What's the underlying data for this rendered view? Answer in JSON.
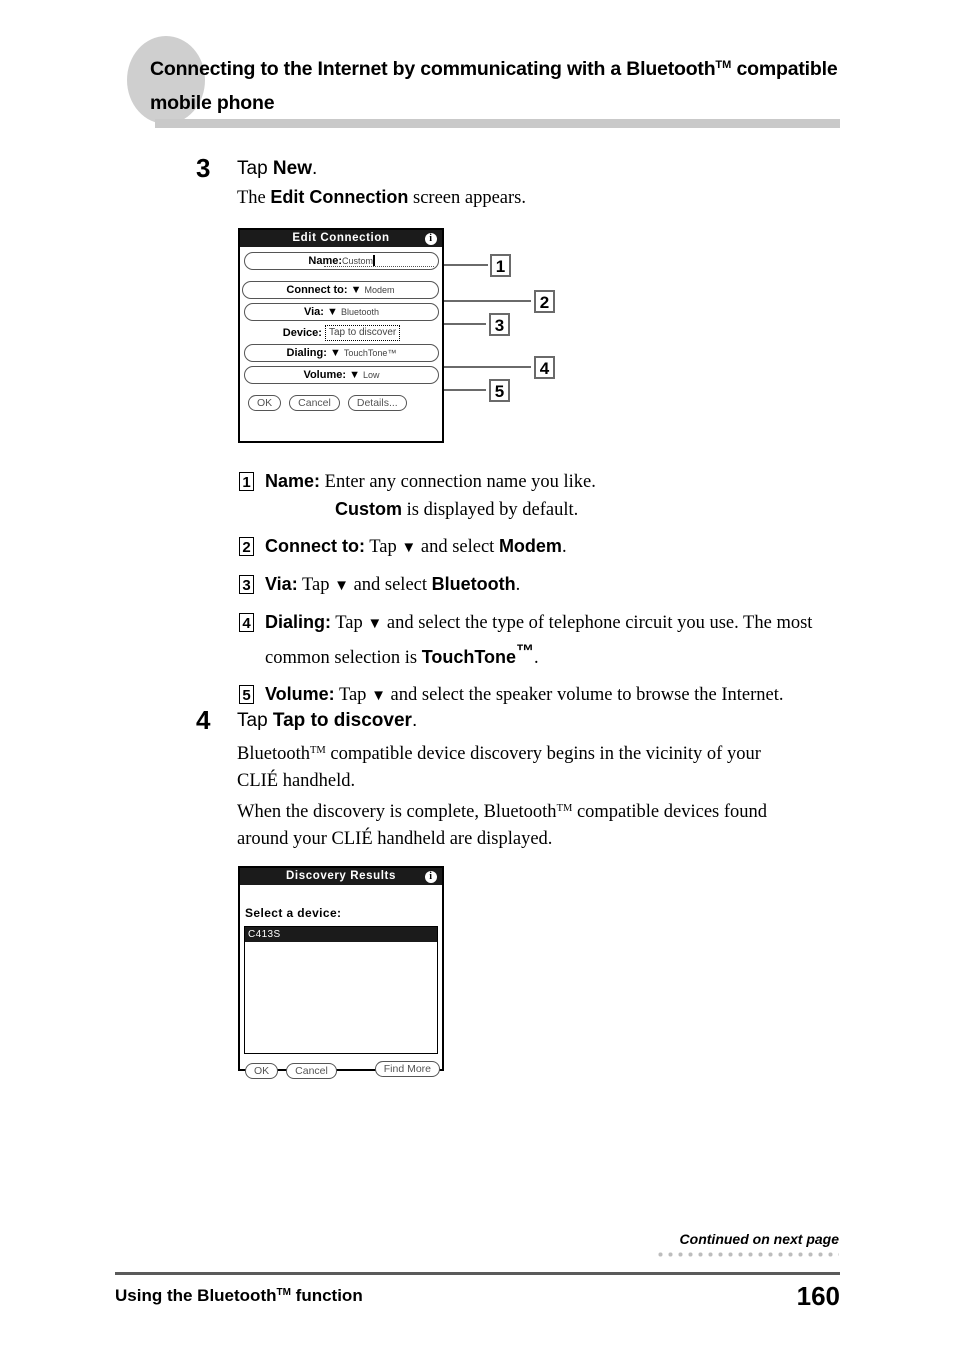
{
  "header": {
    "title_line1": "Connecting to the Internet by communicating with a Bluetooth",
    "title_tm": "TM",
    "title_line1b": " compatible",
    "title_line2": "mobile phone"
  },
  "step3": {
    "number": "3",
    "head_pre": "Tap ",
    "head_bold": "New",
    "head_post": ".",
    "body_pre": "The ",
    "body_bold": "Edit Connection",
    "body_post": " screen appears."
  },
  "edit_connection": {
    "title": "Edit Connection",
    "info_icon": "i",
    "name_label": "Name:",
    "name_value": "Custom",
    "connect_label": "Connect to:",
    "connect_value": "Modem",
    "via_label": "Via:",
    "via_value": "Bluetooth",
    "device_label": "Device:",
    "device_value": "Tap to discover",
    "dialing_label": "Dialing:",
    "dialing_value": "TouchTone™",
    "volume_label": "Volume:",
    "volume_value": "Low",
    "btn_ok": "OK",
    "btn_cancel": "Cancel",
    "btn_details": "Details...",
    "callouts": [
      "1",
      "2",
      "3",
      "4",
      "5"
    ]
  },
  "callout_list": [
    {
      "num": "1",
      "label": "Name:",
      "text": " Enter any connection name you like.",
      "line2_bold": "Custom",
      "line2_text": " is displayed by default."
    },
    {
      "num": "2",
      "label": "Connect to:",
      "text_a": " Tap ",
      "triangle": "▼",
      "text_b": " and select ",
      "strong": "Modem",
      "text_c": "."
    },
    {
      "num": "3",
      "label": "Via:",
      "text_a": " Tap ",
      "triangle": "▼",
      "text_b": " and select ",
      "strong": "Bluetooth",
      "text_c": "."
    },
    {
      "num": "4",
      "label": "Dialing:",
      "text_a": " Tap ",
      "triangle": "▼",
      "text_b": " and select the type of telephone circuit you use. The most common selection is ",
      "strong": "TouchTone",
      "strong_tm": "™",
      "text_c": "."
    },
    {
      "num": "5",
      "label": "Volume:",
      "text_a": " Tap ",
      "triangle": "▼",
      "text_b": " and select the speaker volume to browse the Internet."
    }
  ],
  "step4": {
    "number": "4",
    "head_pre": "Tap ",
    "head_bold": "Tap to discover",
    "head_post": ".",
    "body_line1_a": "Bluetooth",
    "body_line1_tm": "TM",
    "body_line1_b": " compatible device discovery begins in the vicinity of your",
    "body_line2": "CLIÉ handheld.",
    "body_line3_a": "When the discovery is complete, Bluetooth",
    "body_line3_tm": "TM",
    "body_line3_b": " compatible devices found",
    "body_line4": "around your CLIÉ handheld are displayed."
  },
  "discovery_results": {
    "title": "Discovery Results",
    "info_icon": "i",
    "prompt": "Select a device:",
    "devices": [
      "C413S"
    ],
    "btn_ok": "OK",
    "btn_cancel": "Cancel",
    "btn_find_more": "Find More"
  },
  "footer": {
    "continued": "Continued on next page",
    "chapter_a": "Using the Bluetooth",
    "chapter_tm": "TM",
    "chapter_b": " function",
    "page_number": "160"
  }
}
